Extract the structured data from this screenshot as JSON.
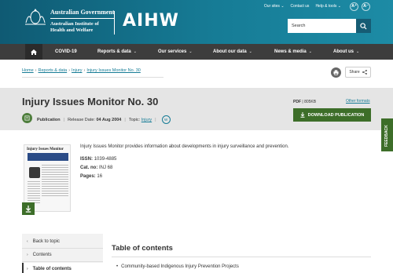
{
  "header": {
    "gov_line1": "Australian Government",
    "gov_line2": "Australian Institute of",
    "gov_line3": "Health and Welfare",
    "logo_text": "AIHW",
    "top_links": [
      "Our sites",
      "Contact us",
      "Help & tools"
    ],
    "font_increase": "A⁺",
    "font_decrease": "A⁻",
    "search_placeholder": "Search"
  },
  "nav": {
    "items": [
      "COVID-19",
      "Reports & data",
      "Our services",
      "About our data",
      "News & media",
      "About us"
    ]
  },
  "breadcrumb": [
    "Home",
    "Reports & data",
    "Injury",
    "Injury Issues Monitor No. 30"
  ],
  "share_label": "Share",
  "title": "Injury Issues Monitor No. 30",
  "meta": {
    "type": "Publication",
    "release_label": "Release Date:",
    "release_date": "04 Aug 2004",
    "topic_label": "Topic:",
    "topic": "Injury",
    "badge": "W"
  },
  "download": {
    "format": "PDF",
    "size": "805KB",
    "other_formats": "Other formats",
    "button": "DOWNLOAD PUBLICATION"
  },
  "feedback_label": "FEEDBACK",
  "cover": {
    "title": "Injury Issues Monitor"
  },
  "description": "Injury Issues Monitor provides information about developments in injury surveillance and prevention.",
  "details": {
    "issn_label": "ISSN:",
    "issn": "1039-4885",
    "cat_label": "Cat. no:",
    "cat": "INJ 68",
    "pages_label": "Pages:",
    "pages": "16"
  },
  "sidebar": {
    "items": [
      "Back to topic",
      "Contents",
      "Table of contents"
    ]
  },
  "toc": {
    "title": "Table of contents",
    "items": [
      "Community-based Indigenous Injury Prevention Projects"
    ]
  },
  "colors": {
    "header_teal": "#167c96",
    "nav_dark": "#3d3d3d",
    "green": "#3d6e29",
    "link": "#167c96"
  }
}
